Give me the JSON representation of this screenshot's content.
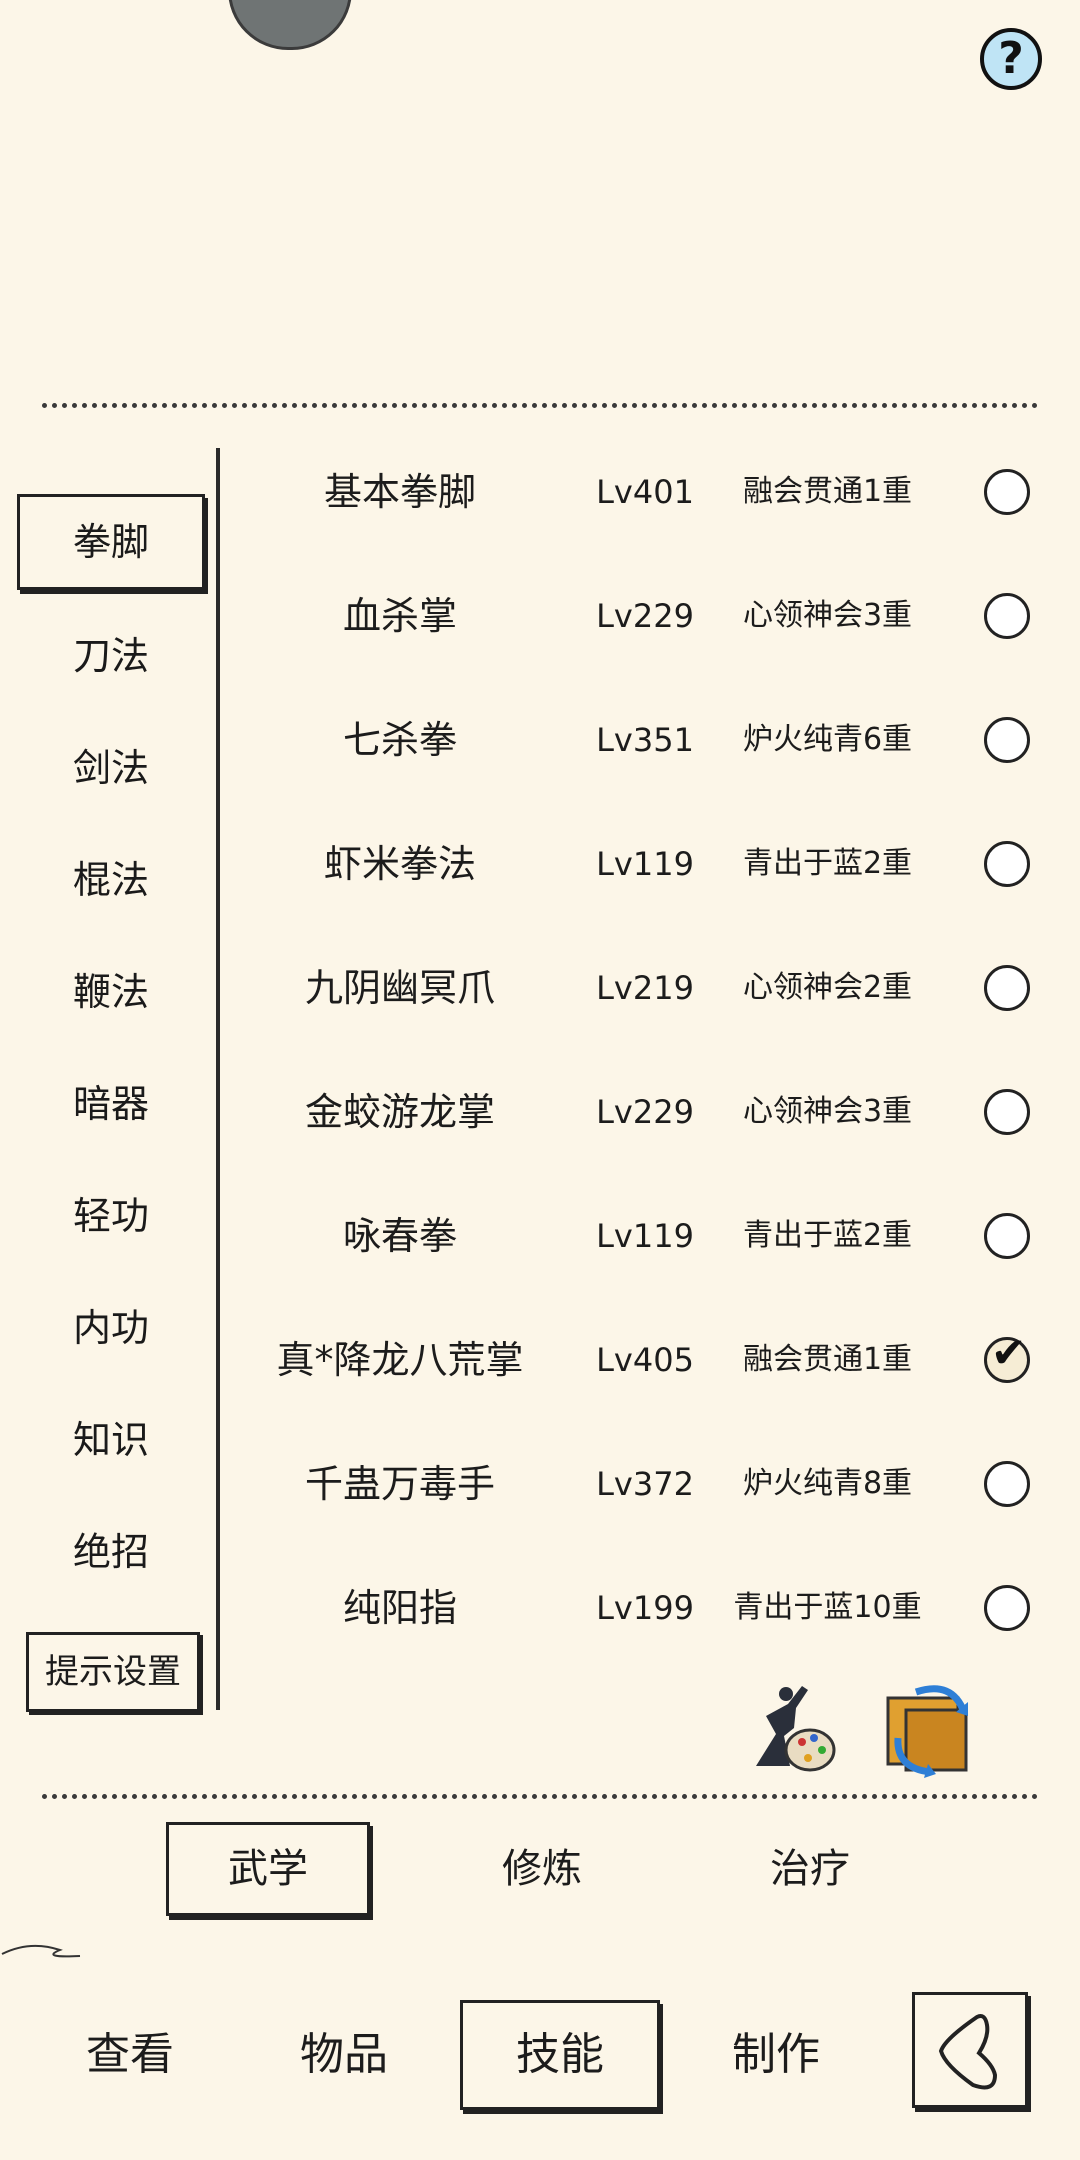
{
  "help_label": "?",
  "categories": [
    {
      "label": "拳脚",
      "selected": true
    },
    {
      "label": "刀法"
    },
    {
      "label": "剑法"
    },
    {
      "label": "棍法"
    },
    {
      "label": "鞭法"
    },
    {
      "label": "暗器"
    },
    {
      "label": "轻功"
    },
    {
      "label": "内功"
    },
    {
      "label": "知识"
    },
    {
      "label": "绝招"
    }
  ],
  "hint_settings_label": "提示设置",
  "skills": [
    {
      "name": "基本拳脚",
      "level": "Lv401",
      "rank": "融会贯通1重",
      "checked": false
    },
    {
      "name": "血杀掌",
      "level": "Lv229",
      "rank": "心领神会3重",
      "checked": false
    },
    {
      "name": "七杀拳",
      "level": "Lv351",
      "rank": "炉火纯青6重",
      "checked": false
    },
    {
      "name": "虾米拳法",
      "level": "Lv119",
      "rank": "青出于蓝2重",
      "checked": false
    },
    {
      "name": "九阴幽冥爪",
      "level": "Lv219",
      "rank": "心领神会2重",
      "checked": false
    },
    {
      "name": "金蛟游龙掌",
      "level": "Lv229",
      "rank": "心领神会3重",
      "checked": false
    },
    {
      "name": "咏春拳",
      "level": "Lv119",
      "rank": "青出于蓝2重",
      "checked": false
    },
    {
      "name": "真*降龙八荒掌",
      "level": "Lv405",
      "rank": "融会贯通1重",
      "checked": true
    },
    {
      "name": "千蛊万毒手",
      "level": "Lv372",
      "rank": "炉火纯青8重",
      "checked": false
    },
    {
      "name": "纯阳指",
      "level": "Lv199",
      "rank": "青出于蓝10重",
      "checked": false
    }
  ],
  "tool_icons": [
    "martial-pose-palette-icon",
    "swap-scroll-icon"
  ],
  "sub_tabs": [
    {
      "label": "武学",
      "selected": true
    },
    {
      "label": "修炼"
    },
    {
      "label": "治疗"
    }
  ],
  "nav_tabs": [
    {
      "label": "查看"
    },
    {
      "label": "物品"
    },
    {
      "label": "技能",
      "selected": true
    },
    {
      "label": "制作"
    }
  ],
  "colors": {
    "background": "#fcf6e8",
    "ink": "#1c1c1c",
    "help_bg": "#bfe4f5"
  }
}
